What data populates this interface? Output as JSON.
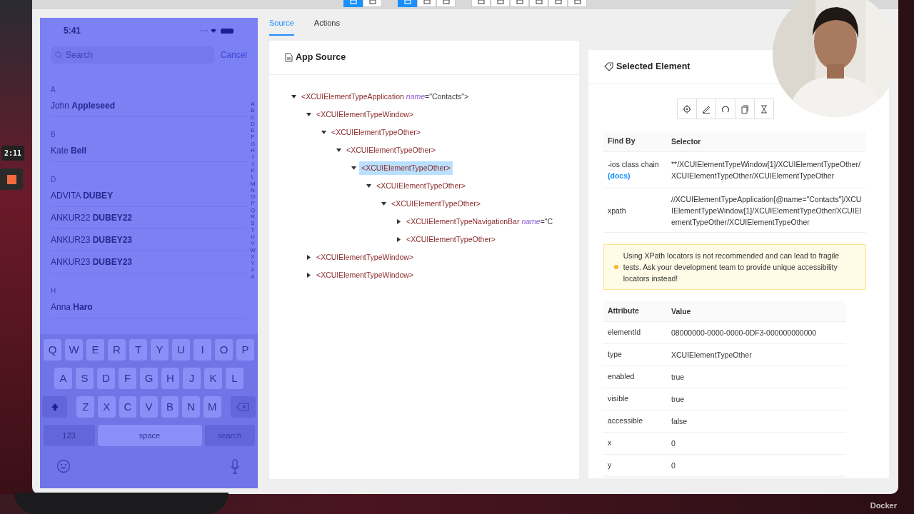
{
  "desktop": {
    "timer": "2:11",
    "dock_label": "Docker"
  },
  "toolbar": {
    "groups": [
      [
        {
          "selected": true
        },
        {
          "selected": false
        }
      ],
      [
        {
          "selected": true
        },
        {
          "selected": false
        },
        {
          "selected": false
        }
      ],
      [
        {
          "selected": false
        },
        {
          "selected": false
        },
        {
          "selected": false
        },
        {
          "selected": false
        },
        {
          "selected": false
        },
        {
          "selected": false
        }
      ]
    ]
  },
  "phone": {
    "time": "5:41",
    "search_placeholder": "Search",
    "cancel": "Cancel",
    "sections": [
      {
        "header": "A",
        "contacts": [
          "John **Appleseed**"
        ]
      },
      {
        "header": "B",
        "contacts": [
          "Kate **Bell**"
        ]
      },
      {
        "header": "D",
        "contacts": [
          "ADVITA **DUBEY**",
          "ANKUR22 **DUBEY22**",
          "ANKUR23 **DUBEY23**",
          "ANKUR23 **DUBEY23**"
        ]
      },
      {
        "header": "H",
        "contacts": [
          "Anna **Haro**"
        ]
      }
    ],
    "index": [
      "A",
      "B",
      "C",
      "D",
      "E",
      "F",
      "G",
      "H",
      "I",
      "J",
      "K",
      "L",
      "M",
      "N",
      "O",
      "P",
      "Q",
      "R",
      "S",
      "T",
      "U",
      "V",
      "W",
      "X",
      "Y",
      "Z",
      "#"
    ],
    "keyboard": {
      "rows": [
        [
          "Q",
          "W",
          "E",
          "R",
          "T",
          "Y",
          "U",
          "I",
          "O",
          "P"
        ],
        [
          "A",
          "S",
          "D",
          "F",
          "G",
          "H",
          "J",
          "K",
          "L"
        ],
        [
          "Z",
          "X",
          "C",
          "V",
          "B",
          "N",
          "M"
        ]
      ],
      "numbers": "123",
      "space": "space",
      "return_key": {
        "label": "search",
        "disabled": true
      }
    }
  },
  "tabs": [
    {
      "label": "Source",
      "selected": true
    },
    {
      "label": "Actions",
      "selected": false
    }
  ],
  "source": {
    "title": "App Source",
    "tree": [
      {
        "open": "<XCUIElementTypeApplication",
        "attr": "name",
        "value": "=\"Contacts\">",
        "expanded": true,
        "selected": false,
        "children": [
          {
            "open": "<XCUIElementTypeWindow>",
            "expanded": true,
            "selected": false,
            "children": [
              {
                "open": "<XCUIElementTypeOther>",
                "expanded": true,
                "selected": false,
                "children": [
                  {
                    "open": "<XCUIElementTypeOther>",
                    "expanded": true,
                    "selected": false,
                    "children": [
                      {
                        "open": "<XCUIElementTypeOther>",
                        "expanded": true,
                        "selected": true,
                        "children": [
                          {
                            "open": "<XCUIElementTypeOther>",
                            "expanded": true,
                            "selected": false,
                            "children": [
                              {
                                "open": "<XCUIElementTypeOther>",
                                "expanded": true,
                                "selected": false,
                                "children": [
                                  {
                                    "open": "<XCUIElementTypeNavigationBar",
                                    "attr": "name",
                                    "value": "=\"C",
                                    "expanded": false,
                                    "selected": false
                                  },
                                  {
                                    "open": "<XCUIElementTypeOther>",
                                    "expanded": false,
                                    "selected": false
                                  }
                                ]
                              }
                            ]
                          }
                        ]
                      }
                    ]
                  }
                ]
              }
            ]
          },
          {
            "open": "<XCUIElementTypeWindow>",
            "expanded": false,
            "selected": false
          },
          {
            "open": "<XCUIElementTypeWindow>",
            "expanded": false,
            "selected": false
          }
        ]
      }
    ]
  },
  "selected_element": {
    "title": "Selected Element",
    "selector_columns": [
      "Find By",
      "Selector"
    ],
    "selectors": [
      {
        "find_by": "-ios class chain",
        "docs": "(docs)",
        "selector": "**/XCUIElementTypeWindow[1]/XCUIElementTypeOther/XCUIElementTypeOther/XCUIElementTypeOther"
      },
      {
        "find_by": "xpath",
        "selector": "//XCUIElementTypeApplication[@name=\"Contacts\"]/XCUIElementTypeWindow[1]/XCUIElementTypeOther/XCUIElementTypeOther/XCUIElementTypeOther"
      }
    ],
    "warning": "Using XPath locators is not recommended and can lead to fragile tests. Ask your development team to provide unique accessibility locators instead!",
    "attribute_columns": [
      "Attribute",
      "Value"
    ],
    "attributes": [
      {
        "name": "elementId",
        "value": "08000000-0000-0000-0DF3-000000000000"
      },
      {
        "name": "type",
        "value": "XCUIElementTypeOther"
      },
      {
        "name": "enabled",
        "value": "true"
      },
      {
        "name": "visible",
        "value": "true"
      },
      {
        "name": "accessible",
        "value": "false"
      },
      {
        "name": "x",
        "value": "0"
      },
      {
        "name": "y",
        "value": "0"
      }
    ]
  }
}
